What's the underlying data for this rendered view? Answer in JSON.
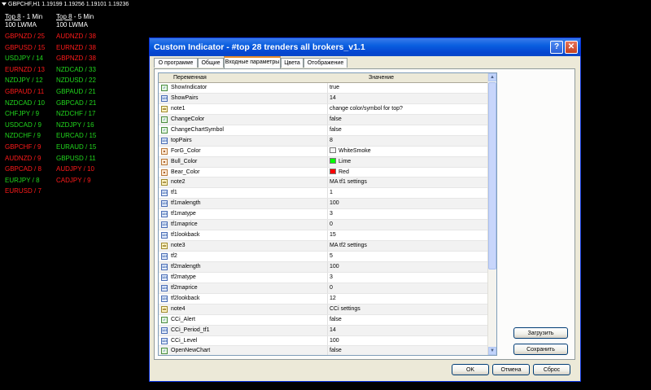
{
  "chart": {
    "header": "GBPCHF,H1  1.19199 1.19256 1.19101 1.19236",
    "col1": {
      "top_label": "Top 8",
      "tf": " - 1 Min",
      "ma": "100 LWMA"
    },
    "col2": {
      "top_label": "Top 8",
      "tf": " - 5 Min",
      "ma": "100 LWMA"
    },
    "col1_pairs": [
      {
        "text": "GBPNZD / 25",
        "color": "red"
      },
      {
        "text": "GBPUSD / 15",
        "color": "red"
      },
      {
        "text": "USDJPY / 14",
        "color": "green"
      },
      {
        "text": "EURNZD / 13",
        "color": "red"
      },
      {
        "text": "NZDJPY / 12",
        "color": "green"
      },
      {
        "text": "GBPAUD / 11",
        "color": "red"
      },
      {
        "text": "NZDCAD / 10",
        "color": "green"
      },
      {
        "text": "CHFJPY / 9",
        "color": "green"
      },
      {
        "text": "USDCAD / 9",
        "color": "green"
      },
      {
        "text": "NZDCHF / 9",
        "color": "green"
      },
      {
        "text": "GBPCHF / 9",
        "color": "red"
      },
      {
        "text": "AUDNZD / 9",
        "color": "red"
      },
      {
        "text": "GBPCAD / 8",
        "color": "red"
      },
      {
        "text": "EURJPY / 8",
        "color": "green"
      },
      {
        "text": "EURUSD / 7",
        "color": "red"
      }
    ],
    "col2_pairs": [
      {
        "text": "AUDNZD / 38",
        "color": "red"
      },
      {
        "text": "EURNZD / 38",
        "color": "red"
      },
      {
        "text": "GBPNZD / 38",
        "color": "red"
      },
      {
        "text": "NZDCAD / 33",
        "color": "green"
      },
      {
        "text": "NZDUSD / 22",
        "color": "green"
      },
      {
        "text": "GBPAUD / 21",
        "color": "green"
      },
      {
        "text": "GBPCAD / 21",
        "color": "green"
      },
      {
        "text": "NZDCHF / 17",
        "color": "green"
      },
      {
        "text": "NZDJPY / 16",
        "color": "green"
      },
      {
        "text": "EURCAD / 15",
        "color": "green"
      },
      {
        "text": "EURAUD / 15",
        "color": "green"
      },
      {
        "text": "GBPUSD / 11",
        "color": "green"
      },
      {
        "text": "AUDJPY / 10",
        "color": "red"
      },
      {
        "text": "CADJPY / 9",
        "color": "red"
      }
    ]
  },
  "dialog": {
    "title": "Custom Indicator - #top 28 trenders all brokers_v1.1",
    "help_label": "?",
    "close_label": "✕",
    "tabs": [
      "О программе",
      "Общие",
      "Входные параметры",
      "Цвета",
      "Отображение"
    ],
    "active_tab": "Входные параметры",
    "columns": {
      "name": "Переменная",
      "value": "Значение"
    },
    "params": [
      {
        "icon": "bool",
        "name": "ShowIndicator",
        "value": "true"
      },
      {
        "icon": "num",
        "name": "ShowPairs",
        "value": "14"
      },
      {
        "icon": "txt",
        "name": "note1",
        "value": "change color/symbol for top?"
      },
      {
        "icon": "bool",
        "name": "ChangeColor",
        "value": "false"
      },
      {
        "icon": "bool",
        "name": "ChangeChartSymbol",
        "value": "false"
      },
      {
        "icon": "num",
        "name": "topPairs",
        "value": "8"
      },
      {
        "icon": "clr",
        "name": "ForG_Color",
        "value": "WhiteSmoke",
        "swatch": "#f5f5f5"
      },
      {
        "icon": "clr",
        "name": "Bull_Color",
        "value": "Lime",
        "swatch": "#00ff00"
      },
      {
        "icon": "clr",
        "name": "Bear_Color",
        "value": "Red",
        "swatch": "#ff0000"
      },
      {
        "icon": "txt",
        "name": "note2",
        "value": "MA tf1 settings"
      },
      {
        "icon": "num",
        "name": "tf1",
        "value": "1"
      },
      {
        "icon": "num",
        "name": "tf1malength",
        "value": "100"
      },
      {
        "icon": "num",
        "name": "tf1matype",
        "value": "3"
      },
      {
        "icon": "num",
        "name": "tf1maprice",
        "value": "0"
      },
      {
        "icon": "num",
        "name": "tf1lookback",
        "value": "15"
      },
      {
        "icon": "txt",
        "name": "note3",
        "value": "MA tf2 settings"
      },
      {
        "icon": "num",
        "name": "tf2",
        "value": "5"
      },
      {
        "icon": "num",
        "name": "tf2malength",
        "value": "100"
      },
      {
        "icon": "num",
        "name": "tf2matype",
        "value": "3"
      },
      {
        "icon": "num",
        "name": "tf2maprice",
        "value": "0"
      },
      {
        "icon": "num",
        "name": "tf2lookback",
        "value": "12"
      },
      {
        "icon": "txt",
        "name": "note4",
        "value": "CCi settings"
      },
      {
        "icon": "bool",
        "name": "CCi_Alert",
        "value": "false"
      },
      {
        "icon": "num",
        "name": "CCi_Period_tf1",
        "value": "14"
      },
      {
        "icon": "num",
        "name": "CCi_Level",
        "value": "100"
      },
      {
        "icon": "bool",
        "name": "OpenNewChart",
        "value": "false"
      }
    ],
    "icon_glyphs": {
      "bool": "✓",
      "num": "123",
      "txt": "ab",
      "clr": "■"
    },
    "buttons": {
      "load": "Загрузить",
      "save": "Сохранить",
      "ok": "OK",
      "cancel": "Отмена",
      "reset": "Сброс"
    }
  }
}
